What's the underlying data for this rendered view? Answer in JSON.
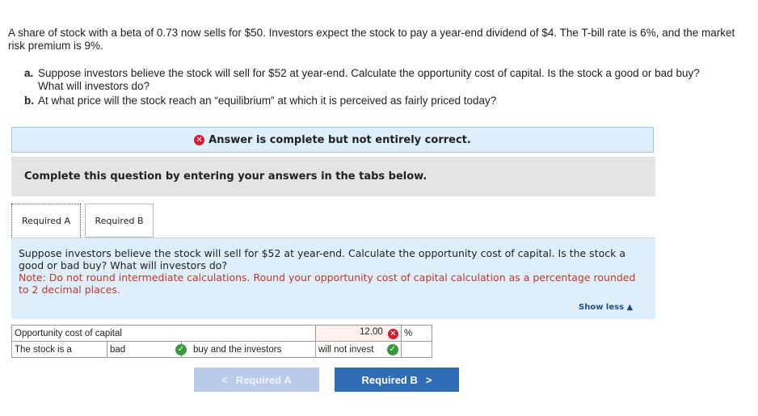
{
  "question": {
    "intro": "A share of stock with a beta of 0.73 now sells for $50. Investors expect the stock to pay a year-end dividend of $4. The T-bill rate is 6%, and the market risk premium is 9%.",
    "items": [
      {
        "letter": "a.",
        "text": "Suppose investors believe the stock will sell for $52 at year-end. Calculate the opportunity cost of capital. Is the stock a good or bad buy? What will investors do?"
      },
      {
        "letter": "b.",
        "text": "At what price will the stock reach an “equilibrium” at which it is perceived as fairly priced today?"
      }
    ]
  },
  "banner": {
    "icon": "x-circle-icon",
    "text": "Answer is complete but not entirely correct."
  },
  "instruction": "Complete this question by entering your answers in the tabs below.",
  "tabs": [
    {
      "label": "Required A",
      "active": true
    },
    {
      "label": "Required B",
      "active": false
    }
  ],
  "panel": {
    "prompt": "Suppose investors believe the stock will sell for $52 at year-end. Calculate the opportunity cost of capital. Is the stock a good or bad buy? What will investors do?",
    "note": "Note: Do not round intermediate calculations. Round your opportunity cost of capital calculation as a percentage rounded to 2 decimal places."
  },
  "show_less": "Show less ▲",
  "answers": {
    "row1": {
      "label": "Opportunity cost of capital",
      "value": "12.00",
      "unit": "%",
      "status": "incorrect"
    },
    "row2": {
      "label": "The stock is a",
      "choice1": "bad",
      "choice1_status": "correct",
      "middle": "buy and the investors",
      "choice2": "will not invest",
      "choice2_status": "correct"
    }
  },
  "nav": {
    "prev": "Required A",
    "next": "Required B"
  },
  "colors": {
    "accent": "#2f6db8",
    "error": "#d7192b",
    "success": "#3a9a3a",
    "note": "#c0392b"
  }
}
